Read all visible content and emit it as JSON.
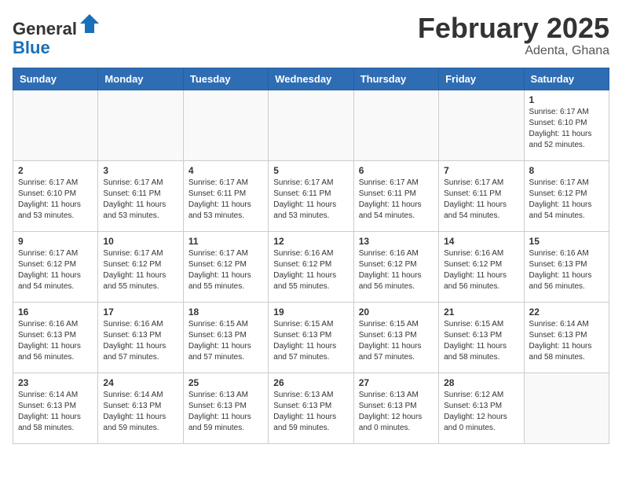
{
  "header": {
    "logo_general": "General",
    "logo_blue": "Blue",
    "cal_title": "February 2025",
    "cal_subtitle": "Adenta, Ghana"
  },
  "days_of_week": [
    "Sunday",
    "Monday",
    "Tuesday",
    "Wednesday",
    "Thursday",
    "Friday",
    "Saturday"
  ],
  "weeks": [
    [
      {
        "day": "",
        "info": ""
      },
      {
        "day": "",
        "info": ""
      },
      {
        "day": "",
        "info": ""
      },
      {
        "day": "",
        "info": ""
      },
      {
        "day": "",
        "info": ""
      },
      {
        "day": "",
        "info": ""
      },
      {
        "day": "1",
        "info": "Sunrise: 6:17 AM\nSunset: 6:10 PM\nDaylight: 11 hours and 52 minutes."
      }
    ],
    [
      {
        "day": "2",
        "info": "Sunrise: 6:17 AM\nSunset: 6:10 PM\nDaylight: 11 hours and 53 minutes."
      },
      {
        "day": "3",
        "info": "Sunrise: 6:17 AM\nSunset: 6:11 PM\nDaylight: 11 hours and 53 minutes."
      },
      {
        "day": "4",
        "info": "Sunrise: 6:17 AM\nSunset: 6:11 PM\nDaylight: 11 hours and 53 minutes."
      },
      {
        "day": "5",
        "info": "Sunrise: 6:17 AM\nSunset: 6:11 PM\nDaylight: 11 hours and 53 minutes."
      },
      {
        "day": "6",
        "info": "Sunrise: 6:17 AM\nSunset: 6:11 PM\nDaylight: 11 hours and 54 minutes."
      },
      {
        "day": "7",
        "info": "Sunrise: 6:17 AM\nSunset: 6:11 PM\nDaylight: 11 hours and 54 minutes."
      },
      {
        "day": "8",
        "info": "Sunrise: 6:17 AM\nSunset: 6:12 PM\nDaylight: 11 hours and 54 minutes."
      }
    ],
    [
      {
        "day": "9",
        "info": "Sunrise: 6:17 AM\nSunset: 6:12 PM\nDaylight: 11 hours and 54 minutes."
      },
      {
        "day": "10",
        "info": "Sunrise: 6:17 AM\nSunset: 6:12 PM\nDaylight: 11 hours and 55 minutes."
      },
      {
        "day": "11",
        "info": "Sunrise: 6:17 AM\nSunset: 6:12 PM\nDaylight: 11 hours and 55 minutes."
      },
      {
        "day": "12",
        "info": "Sunrise: 6:16 AM\nSunset: 6:12 PM\nDaylight: 11 hours and 55 minutes."
      },
      {
        "day": "13",
        "info": "Sunrise: 6:16 AM\nSunset: 6:12 PM\nDaylight: 11 hours and 56 minutes."
      },
      {
        "day": "14",
        "info": "Sunrise: 6:16 AM\nSunset: 6:12 PM\nDaylight: 11 hours and 56 minutes."
      },
      {
        "day": "15",
        "info": "Sunrise: 6:16 AM\nSunset: 6:13 PM\nDaylight: 11 hours and 56 minutes."
      }
    ],
    [
      {
        "day": "16",
        "info": "Sunrise: 6:16 AM\nSunset: 6:13 PM\nDaylight: 11 hours and 56 minutes."
      },
      {
        "day": "17",
        "info": "Sunrise: 6:16 AM\nSunset: 6:13 PM\nDaylight: 11 hours and 57 minutes."
      },
      {
        "day": "18",
        "info": "Sunrise: 6:15 AM\nSunset: 6:13 PM\nDaylight: 11 hours and 57 minutes."
      },
      {
        "day": "19",
        "info": "Sunrise: 6:15 AM\nSunset: 6:13 PM\nDaylight: 11 hours and 57 minutes."
      },
      {
        "day": "20",
        "info": "Sunrise: 6:15 AM\nSunset: 6:13 PM\nDaylight: 11 hours and 57 minutes."
      },
      {
        "day": "21",
        "info": "Sunrise: 6:15 AM\nSunset: 6:13 PM\nDaylight: 11 hours and 58 minutes."
      },
      {
        "day": "22",
        "info": "Sunrise: 6:14 AM\nSunset: 6:13 PM\nDaylight: 11 hours and 58 minutes."
      }
    ],
    [
      {
        "day": "23",
        "info": "Sunrise: 6:14 AM\nSunset: 6:13 PM\nDaylight: 11 hours and 58 minutes."
      },
      {
        "day": "24",
        "info": "Sunrise: 6:14 AM\nSunset: 6:13 PM\nDaylight: 11 hours and 59 minutes."
      },
      {
        "day": "25",
        "info": "Sunrise: 6:13 AM\nSunset: 6:13 PM\nDaylight: 11 hours and 59 minutes."
      },
      {
        "day": "26",
        "info": "Sunrise: 6:13 AM\nSunset: 6:13 PM\nDaylight: 11 hours and 59 minutes."
      },
      {
        "day": "27",
        "info": "Sunrise: 6:13 AM\nSunset: 6:13 PM\nDaylight: 12 hours and 0 minutes."
      },
      {
        "day": "28",
        "info": "Sunrise: 6:12 AM\nSunset: 6:13 PM\nDaylight: 12 hours and 0 minutes."
      },
      {
        "day": "",
        "info": ""
      }
    ]
  ]
}
